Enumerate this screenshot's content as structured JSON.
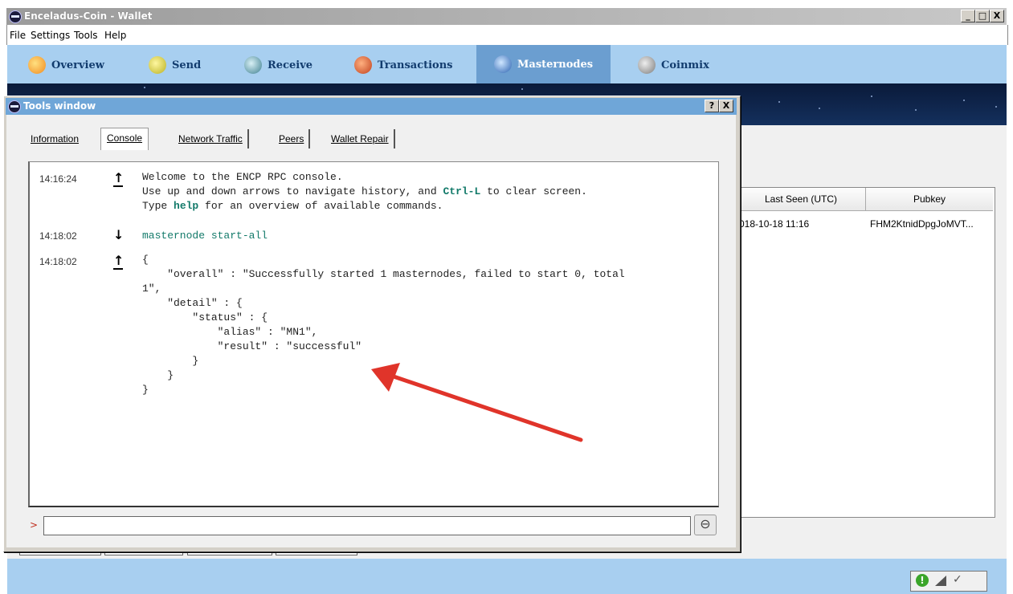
{
  "main_window": {
    "title": "Enceladus-Coin - Wallet",
    "caption_buttons": [
      "_",
      "□",
      "X"
    ]
  },
  "menu": [
    "File",
    "Settings",
    "Tools",
    "Help"
  ],
  "nav": [
    {
      "label": "Overview",
      "icon": "overview-icon",
      "color": "#f0a040"
    },
    {
      "label": "Send",
      "icon": "send-icon",
      "color": "#d9d430"
    },
    {
      "label": "Receive",
      "icon": "receive-icon",
      "color": "#5aa0b0"
    },
    {
      "label": "Transactions",
      "icon": "transactions-icon",
      "color": "#d65a2c"
    },
    {
      "label": "Masternodes",
      "icon": "masternodes-icon",
      "color": "#3b7fcf",
      "active": true
    },
    {
      "label": "Coinmix",
      "icon": "coinmix-icon",
      "color": "#9a9a9a"
    }
  ],
  "masternode_table": {
    "headers": [
      "Last Seen (UTC)",
      "Pubkey"
    ],
    "rows": [
      [
        "018-10-18 11:16",
        "FHM2KtnidDpgJoMVT..."
      ]
    ]
  },
  "tools_window": {
    "title": "Tools window",
    "caption_buttons": [
      "?",
      "X"
    ],
    "tabs": [
      "Information",
      "Console",
      "Network Traffic",
      "Peers",
      "Wallet Repair"
    ],
    "active_tab": "Console"
  },
  "console": {
    "entries": [
      {
        "time": "14:16:24",
        "direction": "up",
        "lines": [
          "Welcome to the ENCP RPC console.",
          "Use up and down arrows to navigate history, and Ctrl-L to clear screen.",
          "Type help for an overview of available commands."
        ]
      },
      {
        "time": "14:18:02",
        "direction": "down",
        "lines": [
          "masternode start-all"
        ]
      },
      {
        "time": "14:18:02",
        "direction": "up",
        "lines": [
          "{",
          "    \"overall\" : \"Successfully started 1 masternodes, failed to start 0, total",
          "1\",",
          "    \"detail\" : {",
          "        \"status\" : {",
          "            \"alias\" : \"MN1\",",
          "            \"result\" : \"successful\"",
          "        }",
          "    }",
          "}"
        ]
      }
    ],
    "prompt": ">",
    "input_value": ""
  },
  "colors": {
    "nav_bg": "#a8cff0",
    "nav_active": "#6b9ed0",
    "annotation_arrow": "#e0342a"
  }
}
